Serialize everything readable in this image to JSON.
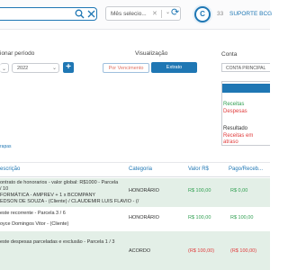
{
  "header": {
    "month_select": "Mês selecio...",
    "user_badge": "33",
    "support_label": "SUPORTE BCG"
  },
  "filters": {
    "periodo_label": "ionar período",
    "year_value": "2022",
    "visualizacao_label": "Visualização",
    "vencimento_label": "Por Vencimento",
    "extrato_label": "Extrato",
    "conta_label": "Conta",
    "conta_value": "CONTA PRINCIPAL"
  },
  "legend": {
    "receitas": "Receitas",
    "despesas": "Despesas",
    "resultado": "Resultado",
    "atraso": "Receitas em atraso"
  },
  "side_link": "rapas",
  "table": {
    "headers": {
      "descricao": "escrição",
      "categoria": "Categoria",
      "valor": "Valor R$",
      "pago": "Pago/Receb..."
    },
    "rows": [
      {
        "lines": [
          "ontrato de honorarios - valor global: R$1000 - Parcela",
          "/ 10",
          "FORMÁTICA - AMPREV + 1 x BCOMPANY",
          "EDSON DE SOUZA - (Cliente) / CLAUDEMIR LUIS FLAVIO - (/"
        ],
        "categoria": "HONORÁRIO",
        "valor": "R$ 100,00",
        "pago": "R$ 0,00"
      },
      {
        "lines": [
          "este recorrente - Parcela 3 / 6",
          "oyce Domingos Vitor - (Cliente)"
        ],
        "categoria": "HONORÁRIO",
        "valor": "R$ 100,00",
        "pago": "R$ 100,00"
      },
      {
        "lines": [
          "este despesas parceladas e exclusão - Parcela 1 / 3"
        ],
        "categoria": "ACORDO",
        "valor": "(R$ 100,00)",
        "pago": "(R$ 100,00)"
      }
    ]
  },
  "colors": {
    "primary": "#1f77b4",
    "receitas": "#2e9e4f",
    "despesas": "#e03b3b",
    "row_highlight": "#e3efe7"
  }
}
